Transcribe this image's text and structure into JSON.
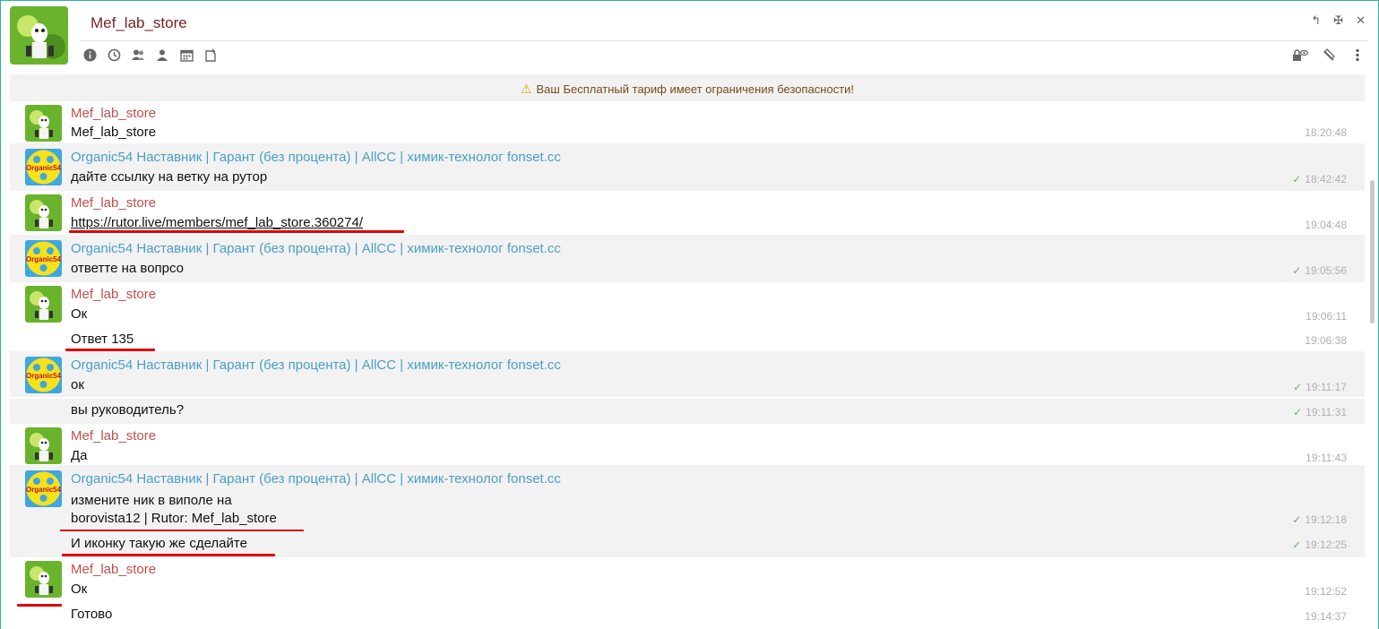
{
  "window": {
    "title": "Mef_lab_store"
  },
  "toolbar": {
    "icons": [
      "info-icon",
      "history-icon",
      "group-icon",
      "contacts-icon",
      "calendar-icon",
      "note-icon"
    ]
  },
  "window_controls": [
    "restore-icon",
    "pin-icon",
    "close-icon"
  ],
  "right_tools": [
    "lock-eye-icon",
    "clear-icon",
    "more-icon"
  ],
  "warning": {
    "text": "Ваш Бесплатный тариф имеет ограничения безопасности!"
  },
  "messages": [
    {
      "author": "Mef_lab_store",
      "text": "Mef_lab_store",
      "time": "18:20:48",
      "checked": false
    },
    {
      "author": "Organic54 Наставник | Гарант (без процента) | AllCC | химик-технолог fonset.cc",
      "text": "дайте ссылку на ветку на рутор",
      "time": "18:42:42",
      "checked": true
    },
    {
      "author": "Mef_lab_store",
      "text": "https://rutor.live/members/mef_lab_store.360274/",
      "time": "19:04:48",
      "checked": false
    },
    {
      "author": "Organic54 Наставник | Гарант (без процента) | AllCC | химик-технолог fonset.cc",
      "text": "ответте на вопрсо",
      "time": "19:05:56",
      "checked": true
    },
    {
      "author": "Mef_lab_store",
      "text": "Ок",
      "time": "19:06:11",
      "checked": false
    },
    {
      "text": "Ответ 135",
      "time": "19:06:38",
      "checked": false
    },
    {
      "author": "Organic54 Наставник | Гарант (без процента) | AllCC | химик-технолог fonset.cc",
      "text": "ок",
      "time": "19:11:17",
      "checked": true
    },
    {
      "text": "вы руководитель?",
      "time": "19:11:31",
      "checked": true
    },
    {
      "author": "Mef_lab_store",
      "text": "Да",
      "time": "19:11:43",
      "checked": false
    },
    {
      "author": "Organic54 Наставник | Гарант (без процента) | AllCC | химик-технолог fonset.cc",
      "text": "измените ник в виполе на",
      "text2": "borovista12 | Rutor: Mef_lab_store",
      "time": "19:12:18",
      "checked": true
    },
    {
      "text": "И иконку такую же сделайте",
      "time": "19:12:25",
      "checked": true
    },
    {
      "author": "Mef_lab_store",
      "text": "Ок",
      "time": "19:12:52",
      "checked": false
    },
    {
      "text": "Готово",
      "time": "19:14:37",
      "checked": false
    }
  ],
  "colors": {
    "mef_author": "#c0504d",
    "organic_author": "#4a9fc8",
    "underline": "#e00000",
    "accent": "#2bb3a0"
  }
}
